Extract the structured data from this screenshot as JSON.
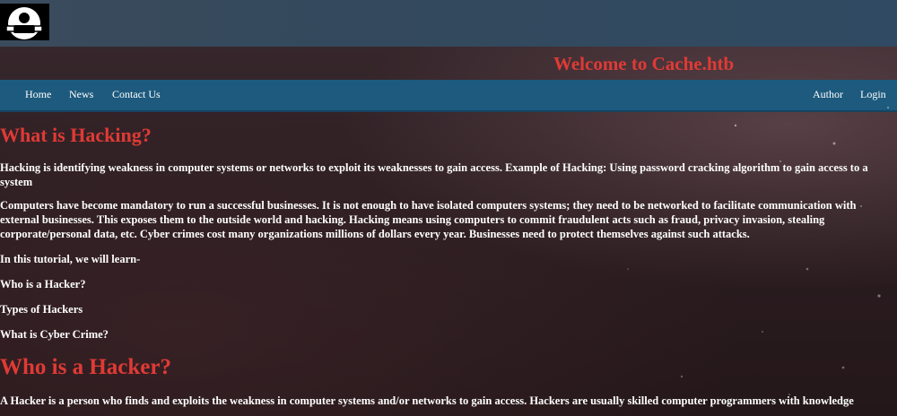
{
  "header": {
    "logo_icon": "user-robot-icon",
    "welcome": "Welcome to Cache.htb"
  },
  "nav": {
    "left": [
      "Home",
      "News",
      "Contact Us"
    ],
    "right": [
      "Author",
      "Login"
    ]
  },
  "colors": {
    "heading": "#e03a35",
    "navbar": "#1d5a7e",
    "text": "#ffffff"
  },
  "content": {
    "heading1": "What is Hacking?",
    "p1": "Hacking is identifying weakness in computer systems or networks to exploit its weaknesses to gain access. Example of Hacking: Using password cracking algorithm to gain access to a system",
    "p2": "Computers have become mandatory to run a successful businesses. It is not enough to have isolated computers systems; they need to be networked to facilitate communication with external businesses. This exposes them to the outside world and hacking. Hacking means using computers to commit fraudulent acts such as fraud, privacy invasion, stealing corporate/personal data, etc. Cyber crimes cost many organizations millions of dollars every year. Businesses need to protect themselves against such attacks.",
    "p3": "In this tutorial, we will learn-",
    "list": [
      "Who is a Hacker?",
      "Types of Hackers",
      "What is Cyber Crime?"
    ],
    "heading2": "Who is a Hacker?",
    "p4": "A Hacker is a person who finds and exploits the weakness in computer systems and/or networks to gain access. Hackers are usually skilled computer programmers with knowledge"
  }
}
